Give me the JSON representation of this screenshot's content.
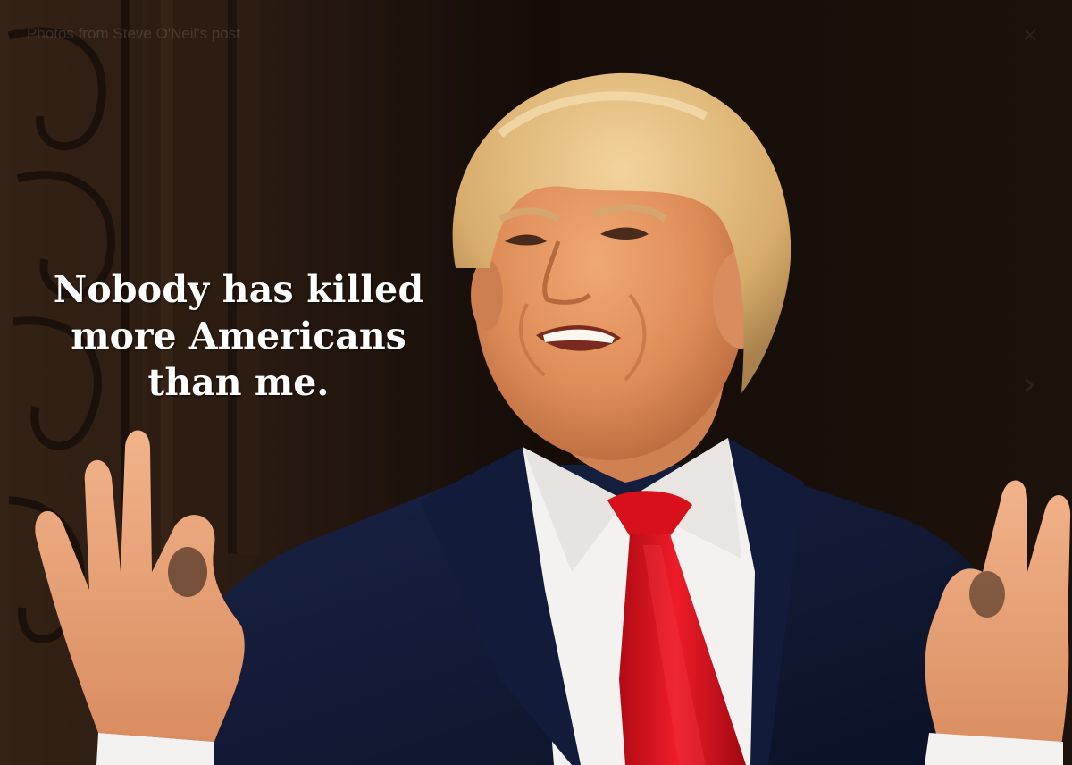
{
  "photo": {
    "source_label": "Photos from Steve O'Neil's post",
    "caption_lines": [
      "Nobody has killed",
      "more Americans",
      "than me."
    ]
  },
  "colors": {
    "suit": "#0e1530",
    "tie": "#d8101b",
    "shirt": "#f4f2f0",
    "skin": "#e39060",
    "hair": "#e2b97a",
    "background": "#1a0f0a",
    "caption_text": "#ffffff"
  },
  "icons": {
    "next": "chevron-right-icon",
    "close": "close-icon"
  }
}
